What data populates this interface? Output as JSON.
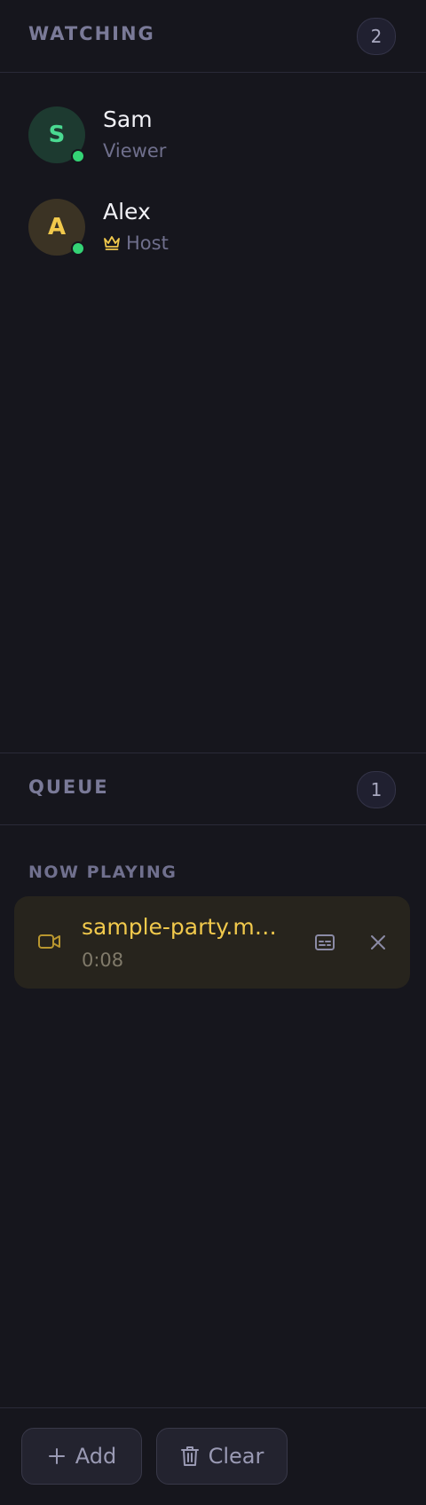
{
  "watching": {
    "title": "WATCHING",
    "count": "2",
    "viewers": [
      {
        "initial": "S",
        "name": "Sam",
        "role": "Viewer",
        "online": true,
        "avatar_color": "#4ad991"
      },
      {
        "initial": "A",
        "name": "Alex",
        "role": "Host",
        "online": true,
        "avatar_color": "#f1c94c",
        "role_icon": "crown-icon"
      }
    ]
  },
  "queue": {
    "title": "QUEUE",
    "count": "1",
    "now_playing_label": "NOW PLAYING",
    "now_playing": {
      "icon": "video-camera-icon",
      "title": "sample-party.m…",
      "time": "0:08"
    }
  },
  "footer": {
    "add_label": "Add",
    "clear_label": "Clear"
  },
  "colors": {
    "background": "#16161d",
    "accent_gold": "#f1c94c",
    "online_green": "#34d375"
  }
}
